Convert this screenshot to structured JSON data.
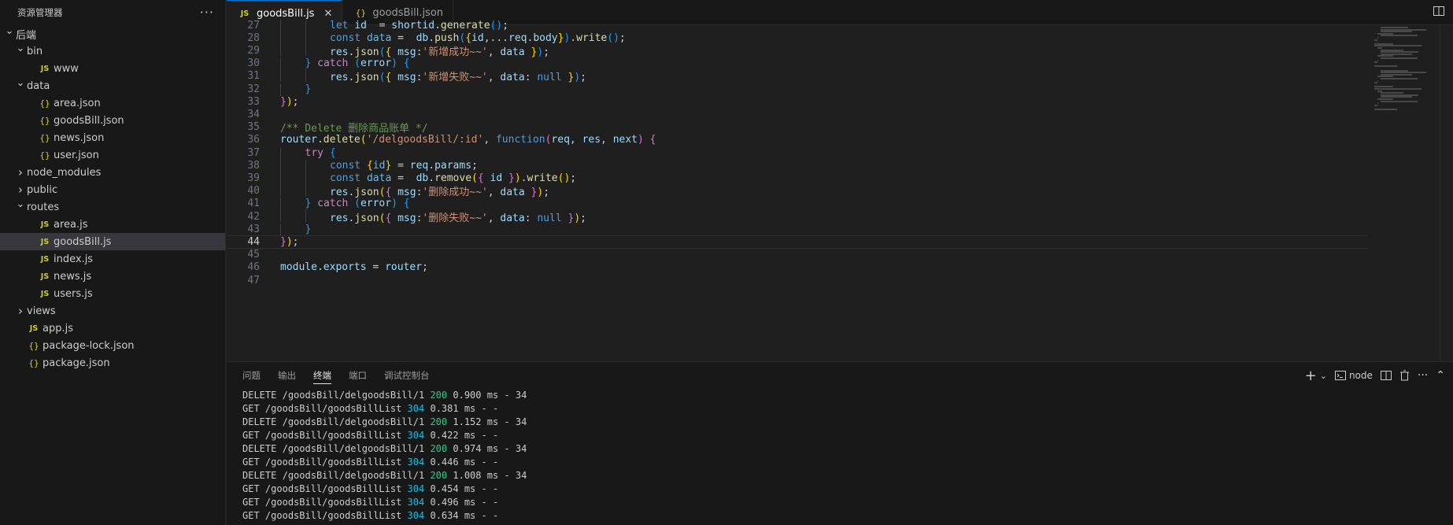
{
  "sidebar": {
    "title": "资源管理器",
    "more": "···",
    "tree": [
      {
        "label": "后端",
        "indent": 0,
        "chevron": "open",
        "icon": ""
      },
      {
        "label": "bin",
        "indent": 1,
        "chevron": "open",
        "icon": ""
      },
      {
        "label": "www",
        "indent": 2,
        "chevron": "",
        "icon": "JS"
      },
      {
        "label": "data",
        "indent": 1,
        "chevron": "open",
        "icon": ""
      },
      {
        "label": "area.json",
        "indent": 2,
        "chevron": "",
        "icon": "{}"
      },
      {
        "label": "goodsBill.json",
        "indent": 2,
        "chevron": "",
        "icon": "{}"
      },
      {
        "label": "news.json",
        "indent": 2,
        "chevron": "",
        "icon": "{}"
      },
      {
        "label": "user.json",
        "indent": 2,
        "chevron": "",
        "icon": "{}"
      },
      {
        "label": "node_modules",
        "indent": 1,
        "chevron": "closed",
        "icon": ""
      },
      {
        "label": "public",
        "indent": 1,
        "chevron": "closed",
        "icon": ""
      },
      {
        "label": "routes",
        "indent": 1,
        "chevron": "open",
        "icon": ""
      },
      {
        "label": "area.js",
        "indent": 2,
        "chevron": "",
        "icon": "JS"
      },
      {
        "label": "goodsBill.js",
        "indent": 2,
        "chevron": "",
        "icon": "JS",
        "selected": true
      },
      {
        "label": "index.js",
        "indent": 2,
        "chevron": "",
        "icon": "JS"
      },
      {
        "label": "news.js",
        "indent": 2,
        "chevron": "",
        "icon": "JS"
      },
      {
        "label": "users.js",
        "indent": 2,
        "chevron": "",
        "icon": "JS"
      },
      {
        "label": "views",
        "indent": 1,
        "chevron": "closed",
        "icon": ""
      },
      {
        "label": "app.js",
        "indent": 1,
        "chevron": "",
        "icon": "JS"
      },
      {
        "label": "package-lock.json",
        "indent": 1,
        "chevron": "",
        "icon": "{}"
      },
      {
        "label": "package.json",
        "indent": 1,
        "chevron": "",
        "icon": "{}"
      }
    ]
  },
  "tabs": [
    {
      "label": "goodsBill.js",
      "icon": "JS",
      "active": true,
      "close": "✕"
    },
    {
      "label": "goodsBill.json",
      "icon": "{}",
      "active": false
    }
  ],
  "editor": {
    "current_line": 44,
    "lines": [
      {
        "n": 27,
        "indent": 2,
        "tokens": [
          [
            "kw",
            "let "
          ],
          [
            "vr",
            "id"
          ],
          [
            "",
            "  = "
          ],
          [
            "vr",
            "shortid"
          ],
          [
            "",
            ""
          ],
          [
            "",
            "."
          ],
          [
            "fn",
            "generate"
          ],
          [
            "p3",
            "()"
          ],
          [
            "",
            ";"
          ]
        ]
      },
      {
        "n": 28,
        "indent": 2,
        "tokens": [
          [
            "kw",
            "const "
          ],
          [
            "cn",
            "data"
          ],
          [
            "",
            " =  "
          ],
          [
            "vr",
            "db"
          ],
          [
            "",
            "."
          ],
          [
            "fn",
            "push"
          ],
          [
            "p3",
            "("
          ],
          [
            "p1",
            "{"
          ],
          [
            "vr",
            "id"
          ],
          [
            "",
            ",..."
          ],
          [
            "vr",
            "req"
          ],
          [
            "",
            "."
          ],
          [
            "vr",
            "body"
          ],
          [
            "p1",
            "}"
          ],
          [
            "p3",
            ")"
          ],
          [
            "",
            "."
          ],
          [
            "fn",
            "write"
          ],
          [
            "p3",
            "()"
          ],
          [
            "",
            ";"
          ]
        ]
      },
      {
        "n": 29,
        "indent": 2,
        "tokens": [
          [
            "vr",
            "res"
          ],
          [
            "",
            "."
          ],
          [
            "fn",
            "json"
          ],
          [
            "p3",
            "("
          ],
          [
            "p1",
            "{ "
          ],
          [
            "vr",
            "msg"
          ],
          [
            "",
            ":"
          ],
          [
            "st",
            "'新增成功~~'"
          ],
          [
            "",
            ", "
          ],
          [
            "vr",
            "data"
          ],
          [
            "p1",
            " }"
          ],
          [
            "p3",
            ")"
          ],
          [
            "",
            ";"
          ]
        ]
      },
      {
        "n": 30,
        "indent": 1,
        "tokens": [
          [
            "p3",
            "} "
          ],
          [
            "kc",
            "catch "
          ],
          [
            "p3",
            "("
          ],
          [
            "vr",
            "error"
          ],
          [
            "p3",
            ") {"
          ]
        ]
      },
      {
        "n": 31,
        "indent": 2,
        "tokens": [
          [
            "vr",
            "res"
          ],
          [
            "",
            "."
          ],
          [
            "fn",
            "json"
          ],
          [
            "p3",
            "("
          ],
          [
            "p1",
            "{ "
          ],
          [
            "vr",
            "msg"
          ],
          [
            "",
            ":"
          ],
          [
            "st",
            "'新增失败~~'"
          ],
          [
            "",
            ", "
          ],
          [
            "vr",
            "data"
          ],
          [
            "",
            ": "
          ],
          [
            "kw",
            "null"
          ],
          [
            "p1",
            " }"
          ],
          [
            "p3",
            ")"
          ],
          [
            "",
            ";"
          ]
        ]
      },
      {
        "n": 32,
        "indent": 1,
        "tokens": [
          [
            "p3",
            "}"
          ]
        ]
      },
      {
        "n": 33,
        "indent": 0,
        "tokens": [
          [
            "p2",
            "}"
          ],
          [
            "p1",
            ")"
          ],
          [
            "",
            ";"
          ]
        ]
      },
      {
        "n": 34,
        "indent": 0,
        "tokens": []
      },
      {
        "n": 35,
        "indent": 0,
        "tokens": [
          [
            "cm",
            "/** Delete 删除商品账单 */"
          ]
        ]
      },
      {
        "n": 36,
        "indent": 0,
        "tokens": [
          [
            "vr",
            "router"
          ],
          [
            "",
            "."
          ],
          [
            "fn",
            "delete"
          ],
          [
            "p1",
            "("
          ],
          [
            "st",
            "'/delgoodsBill/:id'"
          ],
          [
            "",
            ", "
          ],
          [
            "kw",
            "function"
          ],
          [
            "p2",
            "("
          ],
          [
            "pa",
            "req"
          ],
          [
            "",
            ", "
          ],
          [
            "pa",
            "res"
          ],
          [
            "",
            ", "
          ],
          [
            "pa",
            "next"
          ],
          [
            "p2",
            ") {"
          ]
        ]
      },
      {
        "n": 37,
        "indent": 1,
        "tokens": [
          [
            "kc",
            "try "
          ],
          [
            "p3",
            "{"
          ]
        ]
      },
      {
        "n": 38,
        "indent": 2,
        "tokens": [
          [
            "kw",
            "const "
          ],
          [
            "p1",
            "{"
          ],
          [
            "cn",
            "id"
          ],
          [
            "p1",
            "}"
          ],
          [
            "",
            " = "
          ],
          [
            "vr",
            "req"
          ],
          [
            "",
            "."
          ],
          [
            "vr",
            "params"
          ],
          [
            "",
            ";"
          ]
        ]
      },
      {
        "n": 39,
        "indent": 2,
        "tokens": [
          [
            "kw",
            "const "
          ],
          [
            "cn",
            "data"
          ],
          [
            "",
            " =  "
          ],
          [
            "vr",
            "db"
          ],
          [
            "",
            "."
          ],
          [
            "fn",
            "remove"
          ],
          [
            "p1",
            "("
          ],
          [
            "p2",
            "{ "
          ],
          [
            "vr",
            "id"
          ],
          [
            "p2",
            " }"
          ],
          [
            "p1",
            ")"
          ],
          [
            "",
            "."
          ],
          [
            "fn",
            "write"
          ],
          [
            "p1",
            "()"
          ],
          [
            "",
            ";"
          ]
        ]
      },
      {
        "n": 40,
        "indent": 2,
        "tokens": [
          [
            "vr",
            "res"
          ],
          [
            "",
            "."
          ],
          [
            "fn",
            "json"
          ],
          [
            "p1",
            "("
          ],
          [
            "p2",
            "{ "
          ],
          [
            "vr",
            "msg"
          ],
          [
            "",
            ":"
          ],
          [
            "st",
            "'删除成功~~'"
          ],
          [
            "",
            ", "
          ],
          [
            "vr",
            "data"
          ],
          [
            "p2",
            " }"
          ],
          [
            "p1",
            ")"
          ],
          [
            "",
            ";"
          ]
        ]
      },
      {
        "n": 41,
        "indent": 1,
        "tokens": [
          [
            "p3",
            "} "
          ],
          [
            "kc",
            "catch "
          ],
          [
            "p3",
            "("
          ],
          [
            "vr",
            "error"
          ],
          [
            "p3",
            ") {"
          ]
        ]
      },
      {
        "n": 42,
        "indent": 2,
        "tokens": [
          [
            "vr",
            "res"
          ],
          [
            "",
            "."
          ],
          [
            "fn",
            "json"
          ],
          [
            "p1",
            "("
          ],
          [
            "p2",
            "{ "
          ],
          [
            "vr",
            "msg"
          ],
          [
            "",
            ":"
          ],
          [
            "st",
            "'删除失败~~'"
          ],
          [
            "",
            ", "
          ],
          [
            "vr",
            "data"
          ],
          [
            "",
            ": "
          ],
          [
            "kw",
            "null"
          ],
          [
            "p2",
            " }"
          ],
          [
            "p1",
            ")"
          ],
          [
            "",
            ";"
          ]
        ]
      },
      {
        "n": 43,
        "indent": 1,
        "tokens": [
          [
            "p3",
            "}"
          ]
        ]
      },
      {
        "n": 44,
        "indent": 0,
        "tokens": [
          [
            "p2",
            "}"
          ],
          [
            "p1",
            ")"
          ],
          [
            "",
            ";"
          ]
        ]
      },
      {
        "n": 45,
        "indent": 0,
        "tokens": []
      },
      {
        "n": 46,
        "indent": 0,
        "tokens": [
          [
            "vr",
            "module"
          ],
          [
            "",
            "."
          ],
          [
            "vr",
            "exports"
          ],
          [
            "",
            " = "
          ],
          [
            "vr",
            "router"
          ],
          [
            "",
            ";"
          ]
        ]
      },
      {
        "n": 47,
        "indent": 0,
        "tokens": []
      }
    ]
  },
  "panel": {
    "tabs": [
      "问题",
      "输出",
      "终端",
      "端口",
      "调试控制台"
    ],
    "active_tab": "终端",
    "actions": {
      "add": "+",
      "add_chevron": "⌄",
      "shell_label": "node",
      "more": "···",
      "collapse": "⌃"
    },
    "terminal_lines": [
      {
        "method": "DELETE",
        "path": "/goodsBill/delgoodsBill/1",
        "status": "200",
        "rest": "0.900 ms - 34"
      },
      {
        "method": "GET",
        "path": "/goodsBill/goodsBillList",
        "status": "304",
        "rest": "0.381 ms - -"
      },
      {
        "method": "DELETE",
        "path": "/goodsBill/delgoodsBill/1",
        "status": "200",
        "rest": "1.152 ms - 34"
      },
      {
        "method": "GET",
        "path": "/goodsBill/goodsBillList",
        "status": "304",
        "rest": "0.422 ms - -"
      },
      {
        "method": "DELETE",
        "path": "/goodsBill/delgoodsBill/1",
        "status": "200",
        "rest": "0.974 ms - 34"
      },
      {
        "method": "GET",
        "path": "/goodsBill/goodsBillList",
        "status": "304",
        "rest": "0.446 ms - -"
      },
      {
        "method": "DELETE",
        "path": "/goodsBill/delgoodsBill/1",
        "status": "200",
        "rest": "1.008 ms - 34"
      },
      {
        "method": "GET",
        "path": "/goodsBill/goodsBillList",
        "status": "304",
        "rest": "0.454 ms - -"
      },
      {
        "method": "GET",
        "path": "/goodsBill/goodsBillList",
        "status": "304",
        "rest": "0.496 ms - -"
      },
      {
        "method": "GET",
        "path": "/goodsBill/goodsBillList",
        "status": "304",
        "rest": "0.634 ms - -"
      }
    ]
  },
  "colors": {
    "accent": "#0078d4",
    "status_200": "#23d18b",
    "status_304": "#29b8db",
    "js_icon": "#cbcb41"
  }
}
